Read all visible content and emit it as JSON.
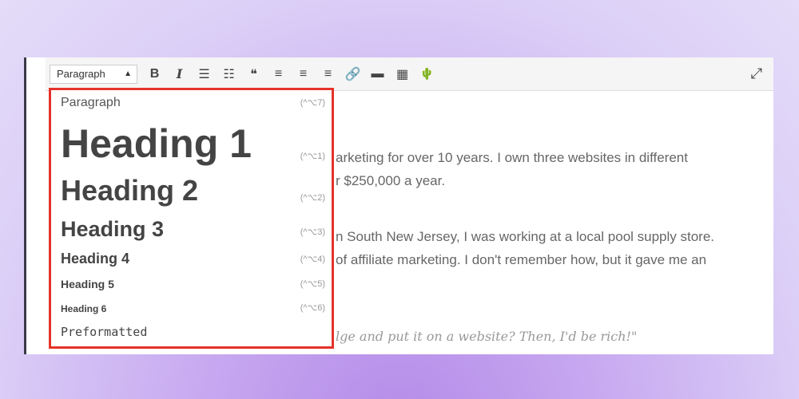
{
  "toolbar": {
    "format_select": "Paragraph",
    "buttons": [
      {
        "name": "bold-icon",
        "glyph": "B"
      },
      {
        "name": "italic-icon",
        "glyph": "I"
      },
      {
        "name": "bullet-list-icon",
        "glyph": "☰"
      },
      {
        "name": "numbered-list-icon",
        "glyph": "☷"
      },
      {
        "name": "blockquote-icon",
        "glyph": "❝"
      },
      {
        "name": "align-left-icon",
        "glyph": "≡"
      },
      {
        "name": "align-center-icon",
        "glyph": "≡"
      },
      {
        "name": "align-right-icon",
        "glyph": "≡"
      },
      {
        "name": "link-icon",
        "glyph": "🔗"
      },
      {
        "name": "read-more-icon",
        "glyph": "▬"
      },
      {
        "name": "toolbar-toggle-icon",
        "glyph": "▦"
      },
      {
        "name": "cactus-icon",
        "glyph": "🌵"
      }
    ],
    "fullscreen_icon": "⤢"
  },
  "content": {
    "lines": [
      "arketing for over 10 years. I own three websites in different",
      "r $250,000 a year.",
      "n South New Jersey, I was working at a local pool supply store.",
      "of affiliate marketing. I don't remember how, but it gave me an"
    ],
    "quote": "lge and put it on a website? Then, I'd be rich!\""
  },
  "dropdown": {
    "items": [
      {
        "label": "Paragraph",
        "shortcut": "(^⌥7)"
      },
      {
        "label": "Heading 1",
        "shortcut": "(^⌥1)"
      },
      {
        "label": "Heading 2",
        "shortcut": "(^⌥2)"
      },
      {
        "label": "Heading 3",
        "shortcut": "(^⌥3)"
      },
      {
        "label": "Heading 4",
        "shortcut": "(^⌥4)"
      },
      {
        "label": "Heading 5",
        "shortcut": "(^⌥5)"
      },
      {
        "label": "Heading 6",
        "shortcut": "(^⌥6)"
      },
      {
        "label": "Preformatted",
        "shortcut": ""
      }
    ]
  },
  "colors": {
    "highlight": "#e5332a",
    "cactus": "#3fb39a"
  }
}
